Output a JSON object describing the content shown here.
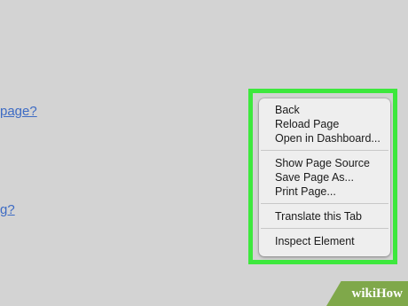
{
  "background_links": [
    {
      "text": "page?"
    },
    {
      "text": "g?"
    }
  ],
  "context_menu": {
    "groups": [
      [
        "Back",
        "Reload Page",
        "Open in Dashboard..."
      ],
      [
        "Show Page Source",
        "Save Page As...",
        "Print Page..."
      ],
      [
        "Translate this Tab"
      ],
      [
        "Inspect Element"
      ]
    ]
  },
  "watermark": {
    "part1": "wiki",
    "part2": "How"
  },
  "colors": {
    "background": "#d3d3d3",
    "link": "#3d6bc4",
    "highlight": "#3de83d",
    "menu_background": "#eeeeee",
    "watermark": "#7fa84a"
  }
}
